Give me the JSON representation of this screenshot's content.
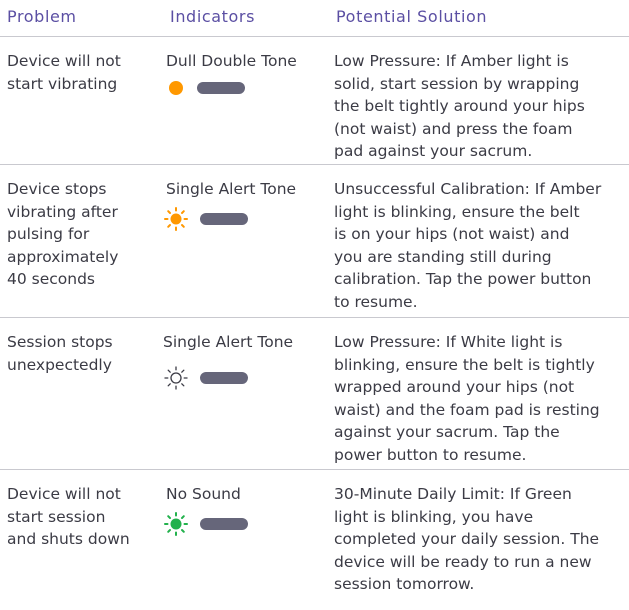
{
  "colors": {
    "header_text": "#5b4fa3",
    "body_text": "#3b3b45",
    "rule": "#c9c9cf",
    "amber": "#ff9800",
    "green": "#22b14c",
    "white_light_outline": "#3b3b45",
    "pill": "#66667a"
  },
  "headers": {
    "problem": "Problem",
    "indicators": "Indicators",
    "solution": "Potential Solution"
  },
  "rows": [
    {
      "problem": "Device will not\nstart vibrating",
      "indicator": "Dull Double Tone",
      "light": "amber-solid-dot-icon",
      "solution": "Low Pressure: If Amber light is\nsolid, start session by wrapping\nthe belt tightly around your hips\n(not waist) and press the foam\npad against your sacrum."
    },
    {
      "problem": "Device stops\nvibrating after\npulsing for\napproximately\n40 seconds",
      "indicator": "Single Alert Tone",
      "light": "amber-blinking-icon",
      "solution": "Unsuccessful Calibration: If Amber\nlight is blinking, ensure the belt\nis on your hips (not waist) and\nyou are standing still during\ncalibration. Tap the power button\nto resume."
    },
    {
      "problem": "Session stops\nunexpectedly",
      "indicator": "Single Alert Tone",
      "light": "white-blinking-icon",
      "solution": "Low Pressure: If White light is\nblinking, ensure the belt is tightly\nwrapped around your hips (not\nwaist) and the foam pad is resting\nagainst your sacrum. Tap the\npower button to resume."
    },
    {
      "problem": "Device will not\nstart session\nand shuts down",
      "indicator": "No Sound",
      "light": "green-blinking-icon",
      "solution": "30-Minute Daily Limit: If Green\nlight is blinking, you have\ncompleted your daily session. The\ndevice will be ready to run a new\nsession tomorrow."
    }
  ]
}
